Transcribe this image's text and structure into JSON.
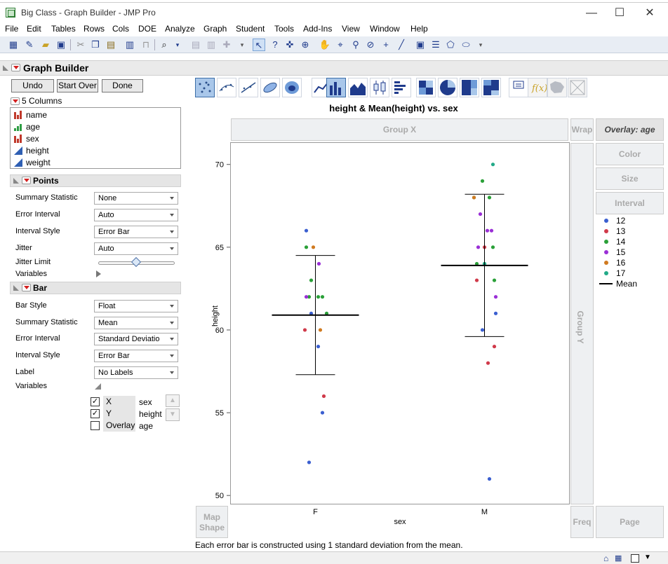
{
  "window": {
    "title": "Big Class - Graph Builder - JMP Pro",
    "minimize": "—",
    "maximize": "☐",
    "close": "✕"
  },
  "menu": [
    "File",
    "Edit",
    "Tables",
    "Rows",
    "Cols",
    "DOE",
    "Analyze",
    "Graph",
    "Student",
    "Tools",
    "Add-Ins",
    "View",
    "Window",
    "Help"
  ],
  "graph_builder": {
    "title": "Graph Builder",
    "buttons": {
      "undo": "Undo",
      "start_over": "Start Over",
      "done": "Done"
    },
    "columns_label": "5 Columns",
    "columns": [
      {
        "name": "name",
        "type": "nominal"
      },
      {
        "name": "age",
        "type": "ordinal"
      },
      {
        "name": "sex",
        "type": "nominal"
      },
      {
        "name": "height",
        "type": "continuous"
      },
      {
        "name": "weight",
        "type": "continuous"
      }
    ]
  },
  "points_section": {
    "title": "Points",
    "rows": [
      {
        "label": "Summary Statistic",
        "value": "None"
      },
      {
        "label": "Error Interval",
        "value": "Auto"
      },
      {
        "label": "Interval Style",
        "value": "Error Bar"
      },
      {
        "label": "Jitter",
        "value": "Auto"
      }
    ],
    "jitter_limit_label": "Jitter Limit",
    "jitter_limit_value": 0.5,
    "variables_label": "Variables"
  },
  "bar_section": {
    "title": "Bar",
    "rows": [
      {
        "label": "Bar Style",
        "value": "Float"
      },
      {
        "label": "Summary Statistic",
        "value": "Mean"
      },
      {
        "label": "Error Interval",
        "value": "Standard Deviatio"
      },
      {
        "label": "Interval Style",
        "value": "Error Bar"
      },
      {
        "label": "Label",
        "value": "No Labels"
      }
    ],
    "variables_label": "Variables",
    "variables": [
      {
        "checked": true,
        "role": "X",
        "name": "sex"
      },
      {
        "checked": true,
        "role": "Y",
        "name": "height"
      },
      {
        "checked": false,
        "role": "Overlay",
        "name": "age"
      }
    ]
  },
  "zones": {
    "group_x": "Group X",
    "wrap": "Wrap",
    "overlay": "Overlay: age",
    "color": "Color",
    "size": "Size",
    "interval": "Interval",
    "group_y": "Group Y",
    "map_shape": "Map\nShape",
    "freq": "Freq",
    "page": "Page"
  },
  "colors": {
    "12": "#3b5fd0",
    "13": "#d03a4a",
    "14": "#2aa038",
    "15": "#9a2fd6",
    "16": "#d07a20",
    "17": "#22aa88"
  },
  "chart_data": {
    "type": "scatter",
    "title": "height & Mean(height) vs. sex",
    "xlabel": "sex",
    "ylabel": "height",
    "categories": [
      "F",
      "M"
    ],
    "ylim": [
      49.5,
      71.3
    ],
    "yticks": [
      50,
      55,
      60,
      65,
      70
    ],
    "series": [
      {
        "name": "12",
        "points": [
          [
            "F",
            66
          ],
          [
            "F",
            61
          ],
          [
            "F",
            59
          ],
          [
            "F",
            55
          ],
          [
            "F",
            52
          ],
          [
            "M",
            61
          ],
          [
            "M",
            60
          ],
          [
            "M",
            51
          ]
        ]
      },
      {
        "name": "13",
        "points": [
          [
            "F",
            60
          ],
          [
            "F",
            56
          ],
          [
            "M",
            65
          ],
          [
            "M",
            63
          ],
          [
            "M",
            59
          ],
          [
            "M",
            58
          ]
        ]
      },
      {
        "name": "14",
        "points": [
          [
            "F",
            65
          ],
          [
            "F",
            63
          ],
          [
            "F",
            62
          ],
          [
            "F",
            62
          ],
          [
            "F",
            62
          ],
          [
            "F",
            61
          ],
          [
            "M",
            69
          ],
          [
            "M",
            68
          ],
          [
            "M",
            68
          ],
          [
            "M",
            65
          ],
          [
            "M",
            64
          ],
          [
            "M",
            64
          ],
          [
            "M",
            63
          ]
        ]
      },
      {
        "name": "15",
        "points": [
          [
            "F",
            64
          ],
          [
            "F",
            62
          ],
          [
            "M",
            67
          ],
          [
            "M",
            66
          ],
          [
            "M",
            66
          ],
          [
            "M",
            65
          ],
          [
            "M",
            62
          ]
        ]
      },
      {
        "name": "16",
        "points": [
          [
            "F",
            65
          ],
          [
            "F",
            60
          ],
          [
            "M",
            68
          ]
        ]
      },
      {
        "name": "17",
        "points": [
          [
            "M",
            70
          ],
          [
            "M",
            64
          ]
        ]
      }
    ],
    "means": [
      {
        "category": "F",
        "mean": 60.9,
        "sd": 3.6
      },
      {
        "category": "M",
        "mean": 63.9,
        "sd": 4.3
      }
    ],
    "legend": [
      "12",
      "13",
      "14",
      "15",
      "16",
      "17"
    ],
    "mean_label": "Mean"
  },
  "footnote": "Each error bar is constructed using 1 standard deviation from the mean."
}
